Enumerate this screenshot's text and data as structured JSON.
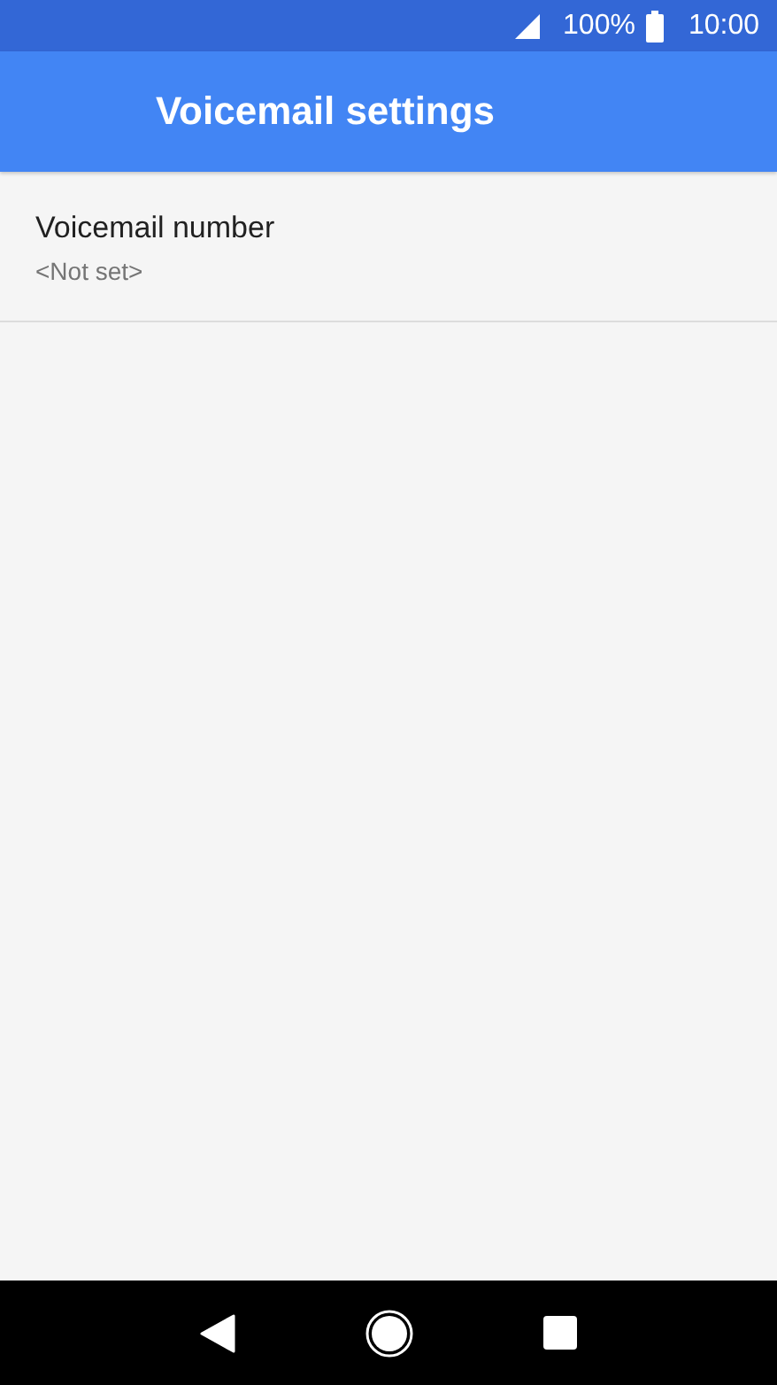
{
  "status_bar": {
    "battery": "100%",
    "time": "10:00"
  },
  "app_bar": {
    "title": "Voicemail settings"
  },
  "settings": [
    {
      "title": "Voicemail number",
      "summary": "<Not set>"
    }
  ]
}
